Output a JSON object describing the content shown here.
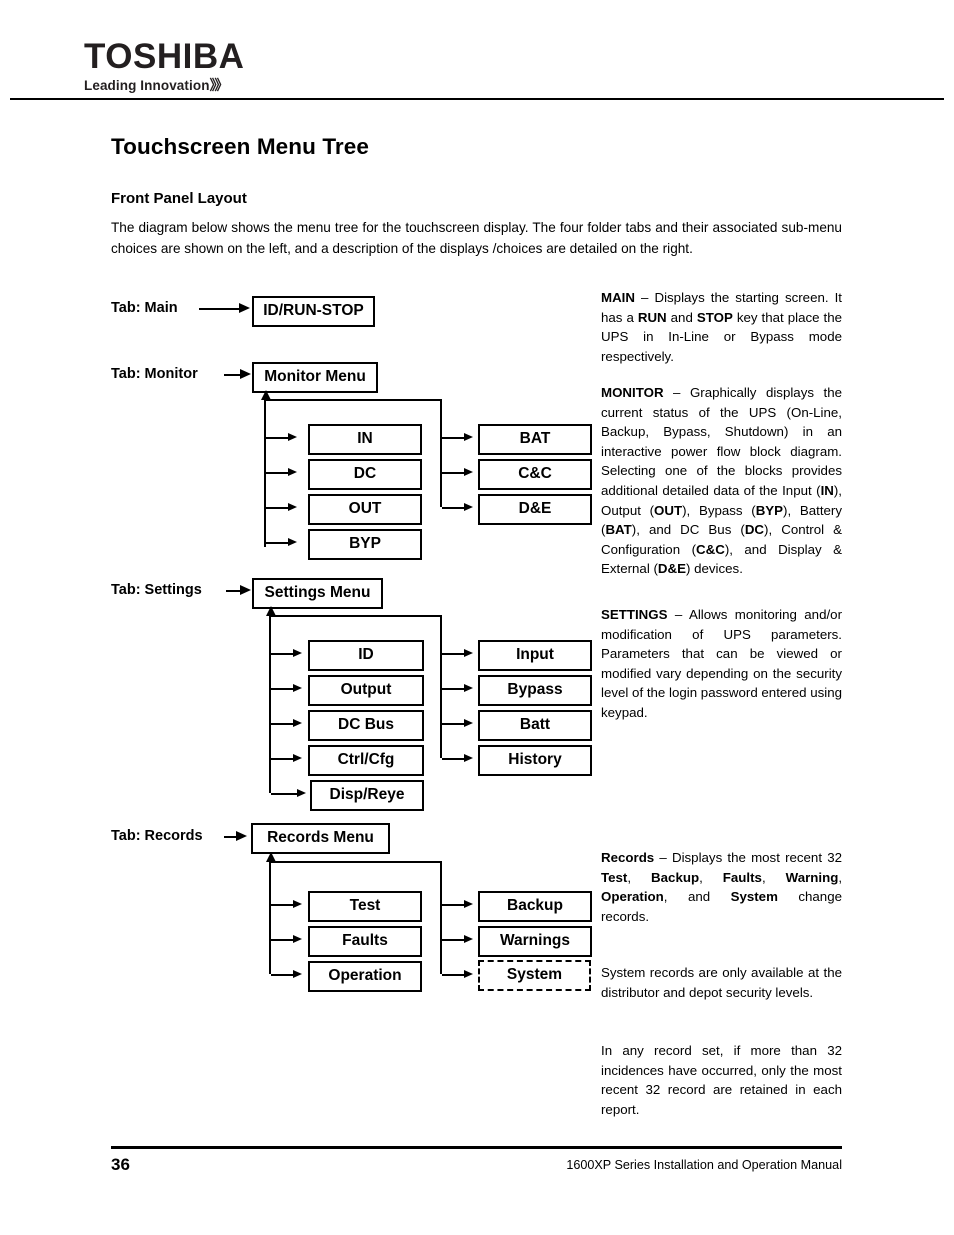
{
  "header": {
    "logo_word": "TOSHIBA",
    "logo_tagline": "Leading Innovation",
    "logo_chevrons": "》》"
  },
  "page_title": "Touchscreen Menu Tree",
  "section_title": "Front Panel Layout",
  "intro": "The diagram below shows the menu tree for the touchscreen display.  The four folder tabs and their associated sub-menu choices are shown on the left, and a description of the displays /choices are detailed on the  right.",
  "diagram": {
    "tabs": [
      {
        "label": "Tab: Main",
        "menu": "ID/RUN-STOP"
      },
      {
        "label": "Tab: Monitor",
        "menu": "Monitor Menu"
      },
      {
        "label": "Tab: Settings",
        "menu": "Settings Menu"
      },
      {
        "label": "Tab: Records",
        "menu": "Records Menu"
      }
    ],
    "monitor": {
      "left": [
        "IN",
        "DC",
        "OUT",
        "BYP"
      ],
      "right": [
        "BAT",
        "C&C",
        "D&E"
      ]
    },
    "settings": {
      "left": [
        "ID",
        "Output",
        "DC Bus",
        "Ctrl/Cfg",
        "Disp/Reye"
      ],
      "right": [
        "Input",
        "Bypass",
        "Batt",
        "History"
      ]
    },
    "records": {
      "left": [
        "Test",
        "Faults",
        "Operation"
      ],
      "right": [
        "Backup",
        "Warnings",
        "System"
      ]
    }
  },
  "descriptions": {
    "main_term": "MAIN",
    "main_text_1": " – Displays the starting screen.  It has a ",
    "main_run": "RUN",
    "main_text_2": " and ",
    "main_stop": "STOP",
    "main_text_3": " key that place the UPS in In-Line or Bypass mode respectively.",
    "monitor_term": "MONITOR",
    "monitor_text_1": " – Graphically displays the current status of the UPS (On-Line, Backup, Bypass, Shutdown) in an interactive power flow block diagram. Selecting one of the blocks provides additional detailed data of the Input (",
    "monitor_in": "IN",
    "monitor_text_2": "), Output (",
    "monitor_out": "OUT",
    "monitor_text_3": "), Bypass (",
    "monitor_byp": "BYP",
    "monitor_text_4": "), Battery (",
    "monitor_bat": "BAT",
    "monitor_text_5": "), and DC Bus (",
    "monitor_dc": "DC",
    "monitor_text_6": "), Control & Configuration (",
    "monitor_cc": "C&C",
    "monitor_text_7": "), and Display & External (",
    "monitor_de": "D&E",
    "monitor_text_8": ") devices.",
    "settings_term": "SETTINGS",
    "settings_text": " – Allows monitoring and/or modification of UPS parameters.  Parameters that can be viewed or modified vary depending on the security level of the login password entered using keypad.",
    "records_term": "Records",
    "records_text_1": " – Displays the most recent 32 ",
    "records_test": "Test",
    "records_text_2": ", ",
    "records_backup": "Backup",
    "records_text_3": ", ",
    "records_faults": "Faults",
    "records_text_4": ", ",
    "records_warning": "Warning",
    "records_text_5": ", ",
    "records_operation": "Operation",
    "records_text_6": ", and ",
    "records_system": "System",
    "records_text_7": " change records.",
    "system_note": "System records are only available at the distributor and depot security levels.",
    "retention_note": "In any record set, if more than 32 incidences have occurred, only the most recent 32 record are retained in each report."
  },
  "footer": {
    "page_number": "36",
    "manual_title": "1600XP Series Installation and Operation Manual"
  }
}
